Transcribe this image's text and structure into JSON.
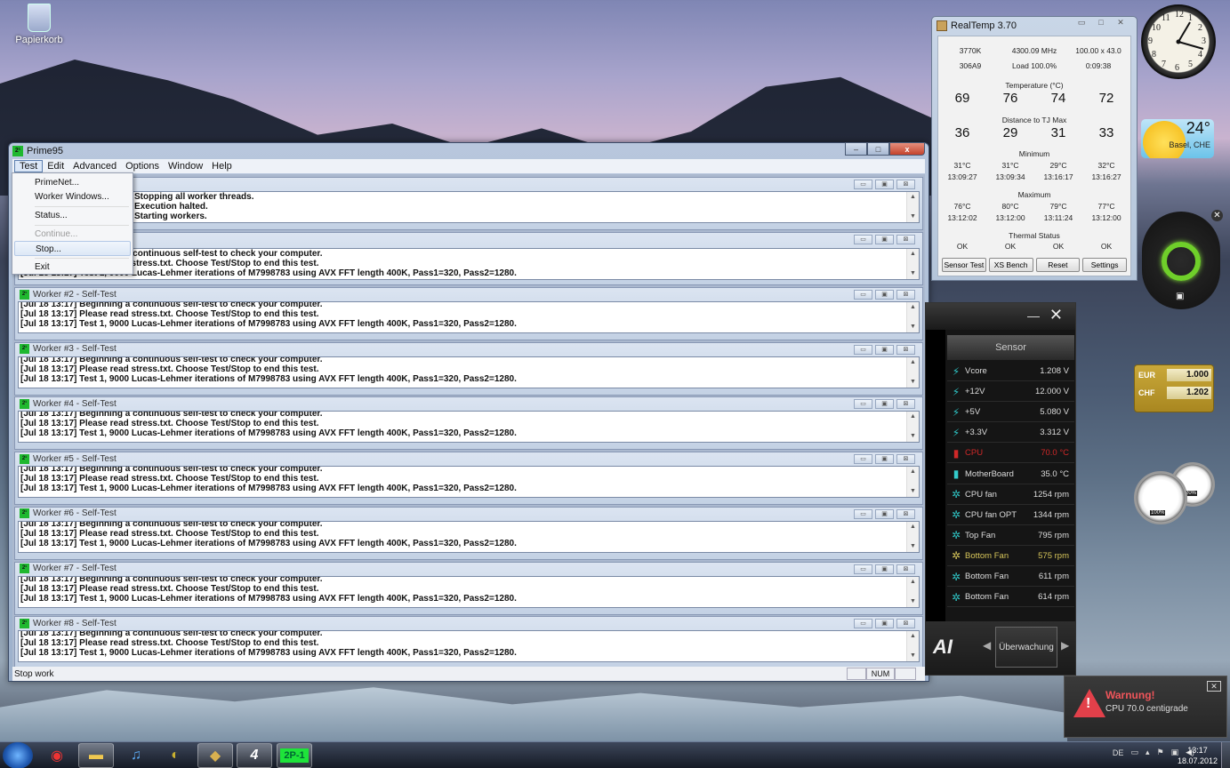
{
  "desktop": {
    "recycle_bin_label": "Papierkorb"
  },
  "prime95": {
    "title": "Prime95",
    "window_buttons": {
      "minimize": "–",
      "maximize": "□",
      "close": "x"
    },
    "menu": [
      "Test",
      "Edit",
      "Advanced",
      "Options",
      "Window",
      "Help"
    ],
    "test_menu": {
      "items": [
        {
          "label": "PrimeNet...",
          "enabled": true
        },
        {
          "label": "Worker Windows...",
          "enabled": true
        },
        {
          "label": "Status...",
          "enabled": true
        },
        {
          "label": "Continue...",
          "enabled": false
        },
        {
          "label": "Stop...",
          "enabled": true,
          "highlighted": true
        },
        {
          "label": "Exit",
          "enabled": true
        }
      ]
    },
    "main_log": [
      "Stopping all worker threads.",
      "Execution halted.",
      "Starting workers."
    ],
    "worker1_log": [
      "[Jul 18 13:17] Beginning a continuous self-test to check your computer.",
      "[Jul 18 13:17] Please read stress.txt.  Choose Test/Stop to end this test.",
      "[Jul 18 13:17] Test 1, 9000 Lucas-Lehmer iterations of M7998783 using AVX FFT length 400K, Pass1=320, Pass2=1280."
    ],
    "workers": [
      {
        "title": "Worker #2 - Self-Test"
      },
      {
        "title": "Worker #3 - Self-Test"
      },
      {
        "title": "Worker #4 - Self-Test"
      },
      {
        "title": "Worker #5 - Self-Test"
      },
      {
        "title": "Worker #6 - Self-Test"
      },
      {
        "title": "Worker #7 - Self-Test"
      },
      {
        "title": "Worker #8 - Self-Test"
      }
    ],
    "worker_log_lines": [
      "[Jul 18 13:17] Beginning a continuous self-test to check your computer.",
      "[Jul 18 13:17] Please read stress.txt.  Choose Test/Stop to end this test.",
      "[Jul 18 13:17] Test 1, 9000 Lucas-Lehmer iterations of M7998783 using AVX FFT length 400K, Pass1=320, Pass2=1280."
    ],
    "status_text": "Stop work",
    "status_num": "NUM"
  },
  "realtemp": {
    "title": "RealTemp 3.70",
    "cpu_model": "3770K",
    "frequency": "4300.09 MHz",
    "multiplier": "100.00 x 43.0",
    "cpuid": "306A9",
    "load": "Load 100.0%",
    "uptime": "0:09:38",
    "temperature_label": "Temperature (°C)",
    "temperatures": [
      "69",
      "76",
      "74",
      "72"
    ],
    "distance_label": "Distance to TJ Max",
    "distances": [
      "36",
      "29",
      "31",
      "33"
    ],
    "minimum_label": "Minimum",
    "minimum_temps": [
      "31°C",
      "31°C",
      "29°C",
      "32°C"
    ],
    "minimum_times": [
      "13:09:27",
      "13:09:34",
      "13:16:17",
      "13:16:27"
    ],
    "maximum_label": "Maximum",
    "maximum_temps": [
      "76°C",
      "80°C",
      "79°C",
      "77°C"
    ],
    "maximum_times": [
      "13:12:02",
      "13:12:00",
      "13:11:24",
      "13:12:00"
    ],
    "thermal_label": "Thermal Status",
    "thermal_status": [
      "OK",
      "OK",
      "OK",
      "OK"
    ],
    "buttons": [
      "Sensor Test",
      "XS Bench",
      "Reset",
      "Settings"
    ]
  },
  "ai_suite": {
    "header": "Sensor",
    "sensors": [
      {
        "icon": "voltage-icon",
        "name": "Vcore",
        "value": "1.208  V",
        "color": "#dddddd"
      },
      {
        "icon": "voltage-icon",
        "name": "+12V",
        "value": "12.000  V",
        "color": "#dddddd"
      },
      {
        "icon": "voltage-icon",
        "name": "+5V",
        "value": "5.080  V",
        "color": "#dddddd"
      },
      {
        "icon": "voltage-icon",
        "name": "+3.3V",
        "value": "3.312  V",
        "color": "#dddddd"
      },
      {
        "icon": "thermometer-icon",
        "name": "CPU",
        "value": "70.0 °C",
        "color": "#d02828"
      },
      {
        "icon": "thermometer-icon",
        "name": "MotherBoard",
        "value": "35.0 °C",
        "color": "#dddddd"
      },
      {
        "icon": "fan-icon",
        "name": "CPU fan",
        "value": "1254  rpm",
        "color": "#dddddd"
      },
      {
        "icon": "fan-icon",
        "name": "CPU fan OPT",
        "value": "1344  rpm",
        "color": "#dddddd"
      },
      {
        "icon": "fan-icon",
        "name": "Top Fan",
        "value": "795  rpm",
        "color": "#dddddd"
      },
      {
        "icon": "fan-icon",
        "name": "Bottom Fan",
        "value": "575  rpm",
        "color": "#d6c55a"
      },
      {
        "icon": "fan-icon",
        "name": "Bottom Fan",
        "value": "611  rpm",
        "color": "#dddddd"
      },
      {
        "icon": "fan-icon",
        "name": "Bottom Fan",
        "value": "614  rpm",
        "color": "#dddddd"
      }
    ],
    "nav_label": "Überwachung",
    "logo": "AI"
  },
  "gadgets": {
    "clock_numbers": [
      "12",
      "1",
      "2",
      "3",
      "4",
      "5",
      "6",
      "7",
      "8",
      "9",
      "10",
      "11"
    ],
    "weather_temp": "24°",
    "weather_location": "Basel, CHE",
    "currency": [
      {
        "code": "EUR",
        "value": "1.000"
      },
      {
        "code": "CHF",
        "value": "1.202"
      }
    ],
    "meter_cpu": "100%",
    "meter_mem": "20%"
  },
  "toast": {
    "title": "Warnung!",
    "message": "CPU 70.0 centigrade",
    "accent": "#f0555a"
  },
  "taskbar": {
    "apps": [
      "start-button",
      "chrome",
      "explorer",
      "itunes",
      "globe-app",
      "realtemp",
      "ai-suite",
      "prime95"
    ],
    "prime95_label": "2P-1",
    "language": "DE",
    "time": "13:17",
    "date": "18.07.2012"
  }
}
